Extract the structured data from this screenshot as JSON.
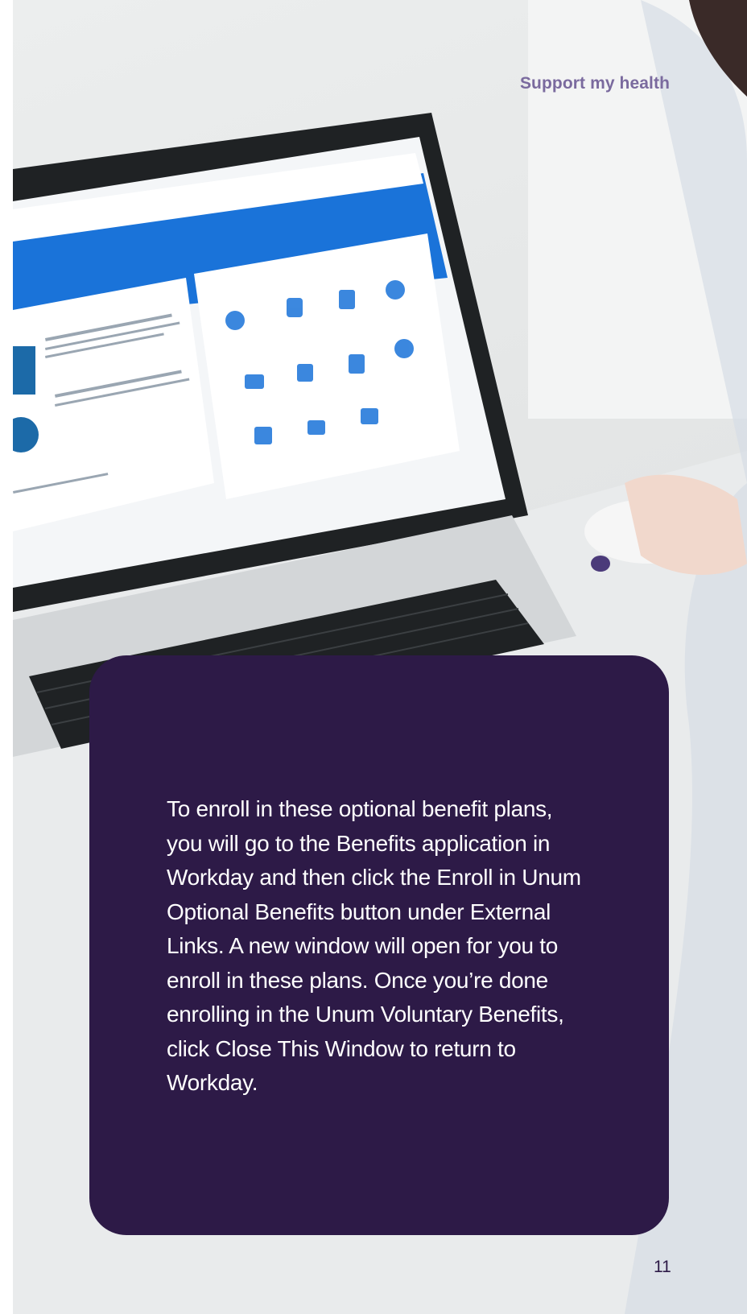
{
  "header": {
    "section_label": "Support my health"
  },
  "info_card": {
    "text": "To enroll in these optional benefit plans, you will go to the Benefits application in Workday and then click the Enroll in Unum Optional Benefits button under External Links. A new window will open for you to enroll in these plans. Once you’re done enrolling in the Unum Voluntary Benefits, click Close This Window to return to Workday."
  },
  "footer": {
    "page_number": "11"
  },
  "photo": {
    "subject": "person-using-laptop-photo",
    "screen_accent": "#1a73d9",
    "card_color": "#2d1a47",
    "label_color": "#7a6a9e"
  }
}
